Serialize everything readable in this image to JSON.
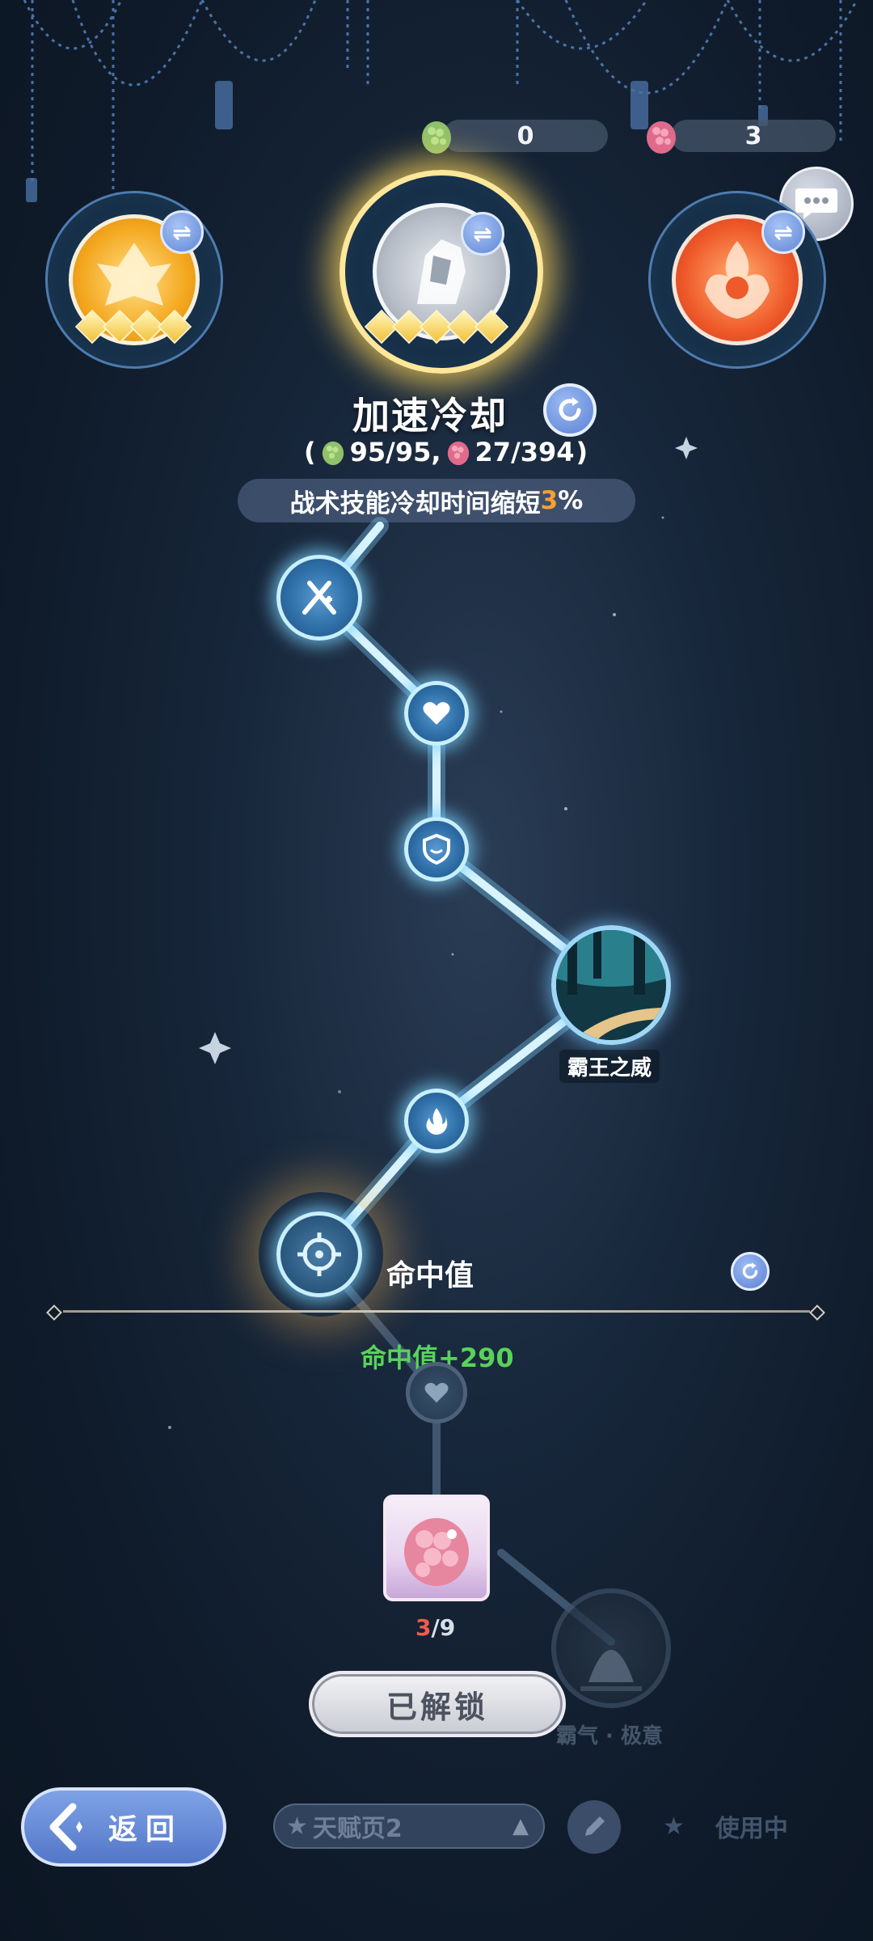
{
  "currency": {
    "green_amount": "0",
    "pink_amount": "3"
  },
  "selected_talent": {
    "name": "加速冷却",
    "cost_open": "(",
    "green_cost": "95/95,",
    "pink_cost": "27/394",
    "cost_close": ")",
    "desc_prefix": "战术技能冷却时间缩短",
    "desc_value": "3",
    "desc_suffix": "%"
  },
  "path_nodes": {
    "boss_node_label": "霸王之威",
    "locked_node_label": "霸气 · 极意"
  },
  "selected_node": {
    "title": "命中值",
    "bonus": "命中值+290",
    "item_have": "3",
    "item_total": "/9",
    "unlock_label": "已解锁"
  },
  "bottom_bar": {
    "back_label": "返回",
    "page_label": "天赋页2",
    "in_use_label": "使用中"
  },
  "colors": {
    "accent_blue": "#5f86d6",
    "path_glow": "#c7efff",
    "bonus_green": "#58d35a",
    "highlight_orange": "#ff9f2e"
  }
}
